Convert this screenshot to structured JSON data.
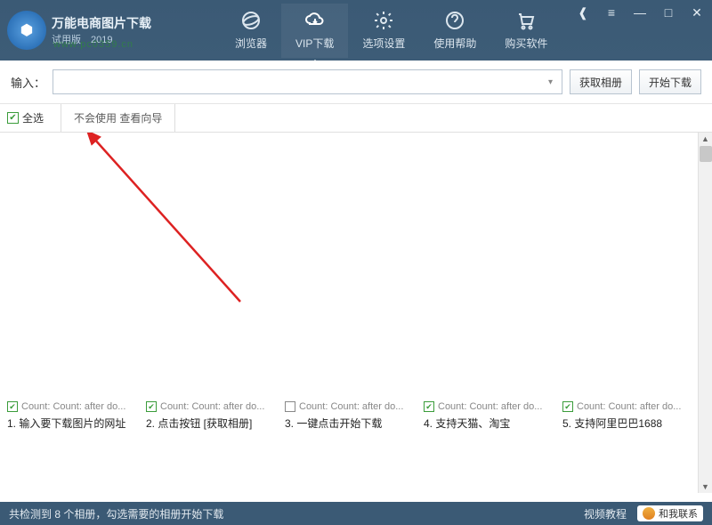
{
  "header": {
    "app_title": "万能电商图片下载",
    "app_subtitle": "试用版　2019",
    "watermark": "www.pc0359.cn"
  },
  "nav": {
    "items": [
      {
        "label": "浏览器",
        "icon": "ie"
      },
      {
        "label": "VIP下载",
        "icon": "cloud"
      },
      {
        "label": "选项设置",
        "icon": "gear"
      },
      {
        "label": "使用帮助",
        "icon": "help"
      },
      {
        "label": "购买软件",
        "icon": "cart"
      }
    ]
  },
  "input_bar": {
    "label": "输入：",
    "value": "",
    "btn_fetch": "获取相册",
    "btn_start": "开始下载"
  },
  "toolbar2": {
    "select_all": "全选",
    "guide": "不会使用 查看向导"
  },
  "thumbs": [
    {
      "checked": true,
      "meta": "Count: Count: after do...",
      "caption": "1. 输入要下载图片的网址"
    },
    {
      "checked": true,
      "meta": "Count: Count: after do...",
      "caption": "2. 点击按钮 [获取相册]"
    },
    {
      "checked": false,
      "meta": "Count: Count: after do...",
      "caption": "3. 一键点击开始下载"
    },
    {
      "checked": true,
      "meta": "Count: Count: after do...",
      "caption": "4. 支持天猫、淘宝"
    },
    {
      "checked": true,
      "meta": "Count: Count: after do...",
      "caption": "5. 支持阿里巴巴1688"
    }
  ],
  "footer": {
    "status": "共检测到 8 个相册，勾选需要的相册开始下载",
    "tutorial": "视频教程",
    "contact": "和我联系"
  },
  "colors": {
    "header_bg": "#3b5a75",
    "accent_green": "#3a9c3a",
    "arrow_red": "#d22"
  }
}
